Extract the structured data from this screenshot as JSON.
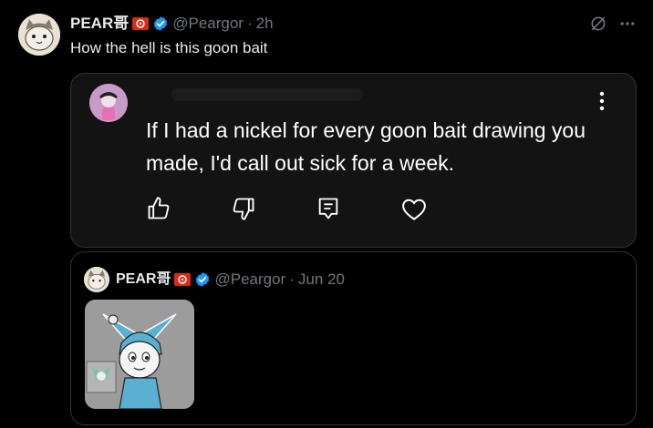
{
  "post": {
    "author_name": "PEAR哥",
    "handle": "@Peargor",
    "separator": "·",
    "time": "2h",
    "text": "How the hell is this goon bait"
  },
  "card": {
    "text": "If I had a nickel for every goon bait drawing you made, I'd call out sick for a week."
  },
  "quoted": {
    "author_name": "PEAR哥",
    "handle": "@Peargor",
    "separator": "·",
    "date": "Jun 20"
  },
  "colors": {
    "background": "#000000",
    "text": "#e7e9ea",
    "muted": "#71767b",
    "verified": "#1d9bf0",
    "card_bg": "#131313",
    "border": "#2f3336",
    "flag_red": "#de2910"
  },
  "icons": [
    "verified-icon",
    "grok-icon",
    "more-icon",
    "thumbs-up-icon",
    "thumbs-down-icon",
    "comment-icon",
    "heart-icon",
    "vertical-more-icon"
  ]
}
